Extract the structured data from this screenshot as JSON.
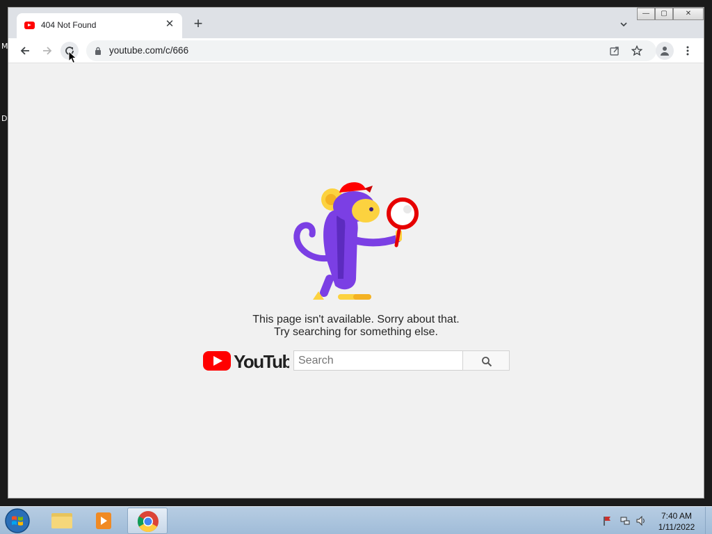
{
  "desktop": {
    "edge_chars": [
      "M",
      "D"
    ]
  },
  "browser": {
    "tab": {
      "title": "404 Not Found",
      "close": "✕"
    },
    "new_tab": "+",
    "window_controls": {
      "minimize": "—",
      "maximize": "▢",
      "close": "✕"
    },
    "address": {
      "url": "youtube.com/c/666"
    }
  },
  "page": {
    "message_line1": "This page isn't available. Sorry about that.",
    "message_line2": "Try searching for something else.",
    "logo_text": "YouTube",
    "search_placeholder": "Search"
  },
  "taskbar": {
    "time": "7:40 AM",
    "date": "1/11/2022"
  },
  "colors": {
    "youtube_red": "#ff0000",
    "monkey_purple": "#7b3fe4",
    "monkey_yellow": "#fcd23f"
  }
}
